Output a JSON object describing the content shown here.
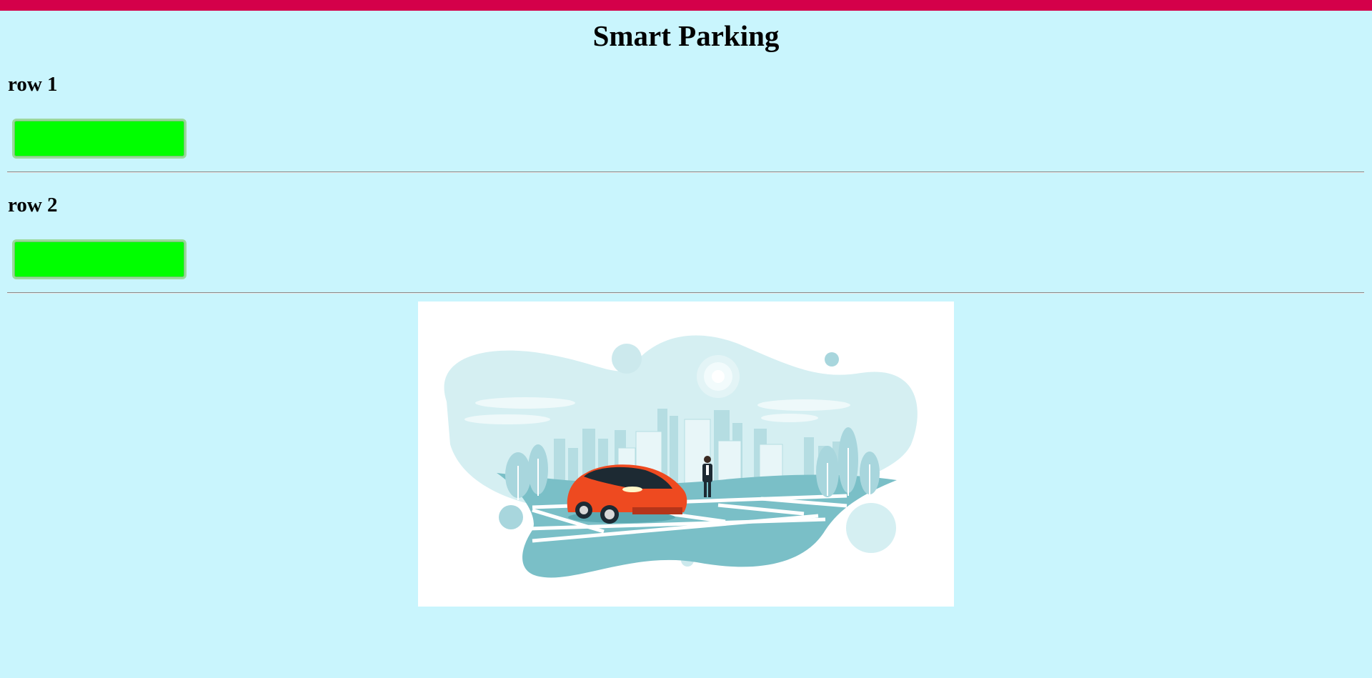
{
  "page": {
    "title": "Smart Parking"
  },
  "rows": [
    {
      "label": "row 1",
      "slot_status": "free",
      "slot_color": "#00ff00"
    },
    {
      "label": "row 2",
      "slot_status": "free",
      "slot_color": "#00ff00"
    }
  ],
  "colors": {
    "top_bar": "#d4004a",
    "background": "#c9f5fd",
    "slot_free": "#00ff00"
  },
  "illustration": {
    "subject": "parking-lot-illustration"
  }
}
